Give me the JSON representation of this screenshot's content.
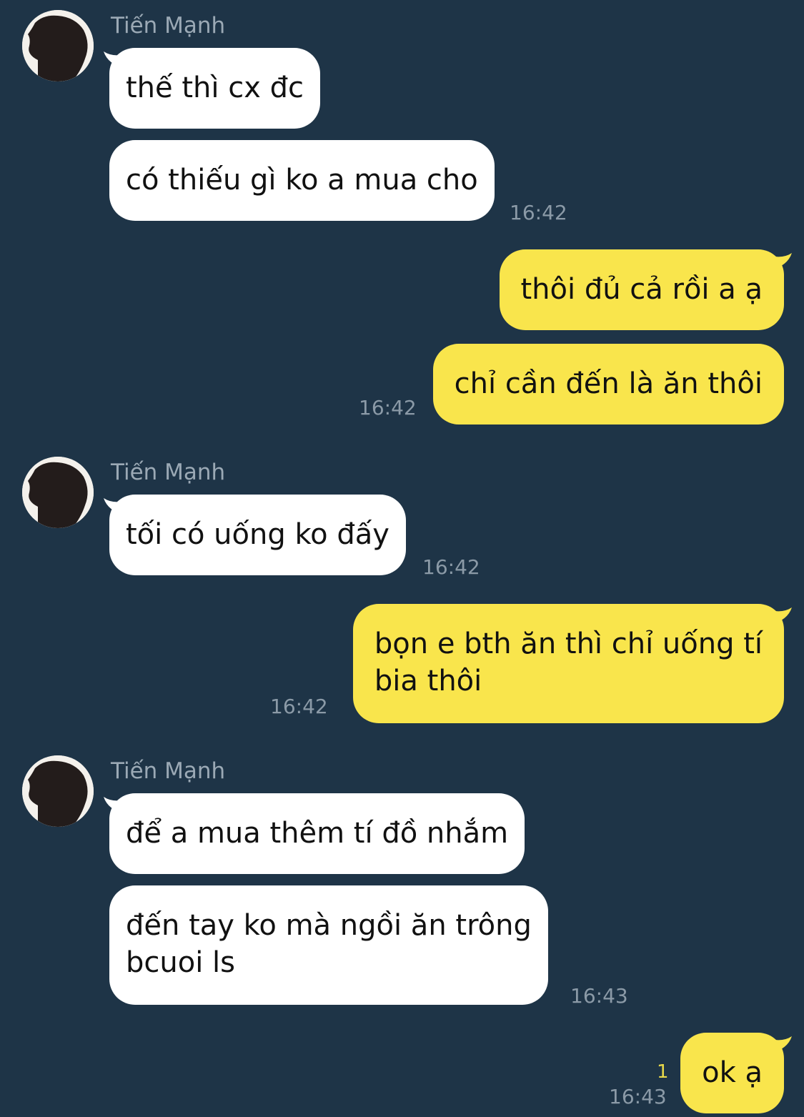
{
  "colors": {
    "background": "#1e3447",
    "incoming_bubble": "#ffffff",
    "outgoing_bubble": "#f9e54c",
    "timestamp": "#8b9aa7",
    "sender_name": "#9ba9b5"
  },
  "icons": {
    "avatar": "user-avatar-icon"
  },
  "groups": [
    {
      "sender": "Tiến Mạnh",
      "messages": [
        {
          "text": "thế thì cx đc"
        },
        {
          "text": "có thiếu gì ko a mua cho",
          "time": "16:42"
        }
      ]
    },
    {
      "sender": "me",
      "messages": [
        {
          "text": "thôi đủ cả rồi a ạ"
        },
        {
          "text": "chỉ cần đến là ăn thôi",
          "time": "16:42"
        }
      ]
    },
    {
      "sender": "Tiến Mạnh",
      "messages": [
        {
          "text": "tối có uống ko đấy",
          "time": "16:42"
        }
      ]
    },
    {
      "sender": "me",
      "messages": [
        {
          "line1": "bọn e bth ăn thì chỉ uống tí",
          "line2": "bia thôi",
          "time": "16:42"
        }
      ]
    },
    {
      "sender": "Tiến Mạnh",
      "messages": [
        {
          "text": "để a mua thêm tí đồ nhắm"
        },
        {
          "line1": "đến tay ko mà ngồi ăn trông",
          "line2": "bcuoi ls",
          "time": "16:43"
        }
      ]
    },
    {
      "sender": "me",
      "messages": [
        {
          "text": "ok ạ",
          "time": "16:43",
          "unread_count": "1"
        }
      ]
    }
  ]
}
